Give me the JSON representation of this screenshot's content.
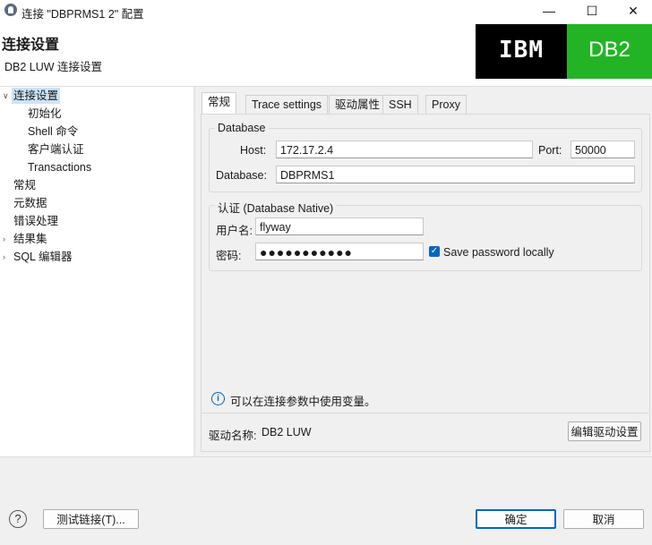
{
  "window": {
    "title": "连接 \"DBPRMS1 2\" 配置",
    "minimize_glyph": "—",
    "maximize_glyph": "☐",
    "close_glyph": "✕"
  },
  "header": {
    "title": "连接设置",
    "subtitle": "DB2 LUW 连接设置",
    "logo_ibm": "IBM",
    "logo_db2": "DB2",
    "colors": {
      "ibm_bg": "#000000",
      "db2_bg": "#22b425"
    }
  },
  "nav": {
    "items": [
      {
        "label": "连接设置",
        "expandable": true,
        "expanded": true
      },
      {
        "label": "初始化"
      },
      {
        "label": "Shell 命令"
      },
      {
        "label": "客户端认证"
      },
      {
        "label": "Transactions"
      },
      {
        "label": "常规"
      },
      {
        "label": "元数据"
      },
      {
        "label": "错误处理"
      },
      {
        "label": "结果集",
        "expandable": true
      },
      {
        "label": "SQL 编辑器",
        "expandable": true
      }
    ]
  },
  "tabs": [
    {
      "label": "常规",
      "active": true
    },
    {
      "label": "Trace settings"
    },
    {
      "label": "驱动属性"
    },
    {
      "label": "SSH"
    },
    {
      "label": "Proxy"
    }
  ],
  "database_group": {
    "legend": "Database",
    "host_label": "Host:",
    "host_value": "172.17.2.4",
    "port_label": "Port:",
    "port_value": "50000",
    "database_label": "Database:",
    "database_value": "DBPRMS1"
  },
  "auth_group": {
    "legend": "认证 (Database Native)",
    "username_label": "用户名:",
    "username_value": "flyway",
    "password_label": "密码:",
    "password_value": "●●●●●●●●●●●",
    "save_password_label": "Save password locally",
    "save_password_checked": true
  },
  "info": {
    "icon": "info-icon",
    "text": "可以在连接参数中使用变量。"
  },
  "driver": {
    "label": "驱动名称:",
    "value": "DB2 LUW",
    "edit_button": "编辑驱动设置"
  },
  "footer": {
    "help_glyph": "?",
    "test_button": "测试链接(T)...",
    "ok_button": "确定",
    "cancel_button": "取消"
  }
}
